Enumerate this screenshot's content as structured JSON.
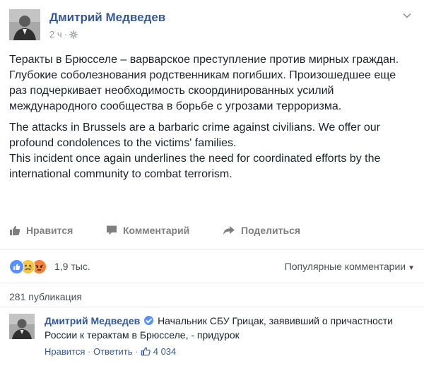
{
  "post": {
    "author": "Дмитрий Медведев",
    "time": "2 ч",
    "text_ru": "Теракты в Брюсселе – варварское преступление против мирных граждан. Глубокие соболезнования родственникам погибших. Произошедшее еще раз подчеркивает необходимость скоординированных усилий международного сообщества в борьбе с угрозами терроризма.",
    "text_en_1": "The attacks in Brussels are a barbaric crime against civilians. We offer our profound condolences to the victims' families.",
    "text_en_2": "This incident once again underlines the need for coordinated efforts by the international community to combat terrorism."
  },
  "actions": {
    "like": "Нравится",
    "comment": "Комментарий",
    "share": "Поделиться"
  },
  "reactions": {
    "count": "1,9 тыс.",
    "sort_label": "Популярные комментарии",
    "icons": [
      "like-icon",
      "sad-icon",
      "angry-icon"
    ]
  },
  "shares": "281 публикация",
  "comment": {
    "author": "Дмитрий Медведев",
    "text": "Начальник СБУ Грицак, заявивший о причастности России к терактам в Брюсселе, - придурок",
    "like": "Нравится",
    "reply": "Ответить",
    "likes_count": "4 034"
  },
  "colors": {
    "link": "#365899",
    "meta": "#90949c",
    "like_blue": "#5890ff",
    "angry_orange": "#f0803c",
    "sad_yellow": "#f7c744"
  }
}
